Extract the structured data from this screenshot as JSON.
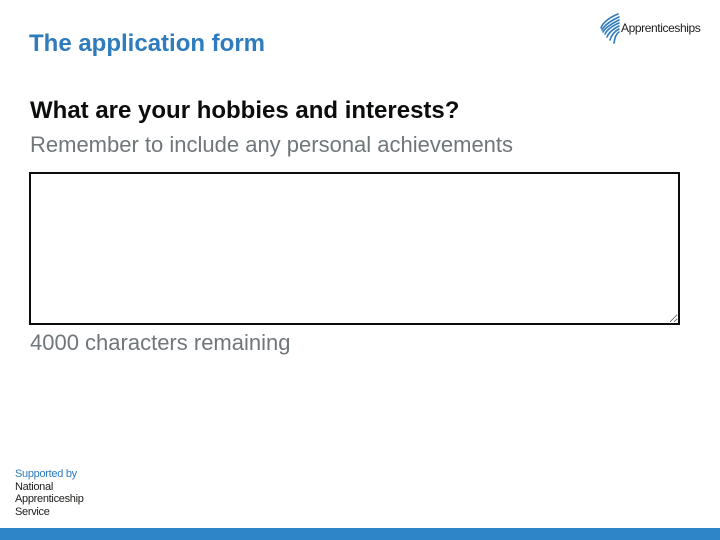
{
  "slide": {
    "title": "The application form"
  },
  "brand": {
    "logo_text": "Apprenticeships",
    "logo_icon": "apprenticeships-wing-icon",
    "color": "#2e7bbd"
  },
  "form": {
    "question": "What are your hobbies and interests?",
    "hint": "Remember to include any personal achievements",
    "textarea_value": "",
    "char_count": "4000 characters remaining"
  },
  "footer": {
    "supported_by": "Supported by",
    "org_lines": [
      "National",
      "Apprenticeship",
      "Service"
    ],
    "bar_color": "#2e86c8"
  }
}
